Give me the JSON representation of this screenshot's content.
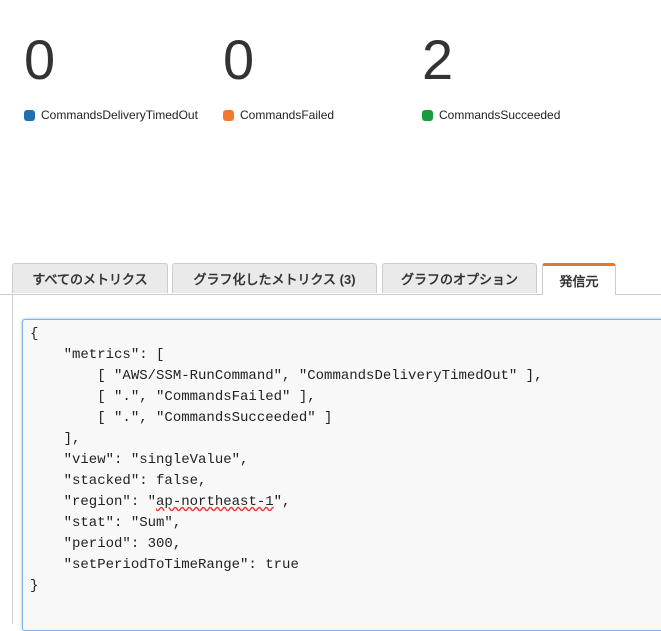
{
  "metrics": [
    {
      "value": "0",
      "label": "CommandsDeliveryTimedOut",
      "color": "#1f6fb2"
    },
    {
      "value": "0",
      "label": "CommandsFailed",
      "color": "#f5792a"
    },
    {
      "value": "2",
      "label": "CommandsSucceeded",
      "color": "#1a9a3a"
    }
  ],
  "tabs": [
    "すべてのメトリクス",
    "グラフ化したメトリクス (3)",
    "グラフのオプション",
    "発信元"
  ],
  "active_tab": "発信元",
  "source_lines": [
    "{",
    "    \"metrics\": [",
    "        [ \"AWS/SSM-RunCommand\", \"CommandsDeliveryTimedOut\" ],",
    "        [ \".\", \"CommandsFailed\" ],",
    "        [ \".\", \"CommandsSucceeded\" ]",
    "    ],",
    "    \"view\": \"singleValue\",",
    "    \"stacked\": false,",
    "    \"region\": \"ap-northeast-1\",",
    "    \"stat\": \"Sum\",",
    "    \"period\": 300,",
    "    \"setPeriodToTimeRange\": true",
    "}"
  ]
}
